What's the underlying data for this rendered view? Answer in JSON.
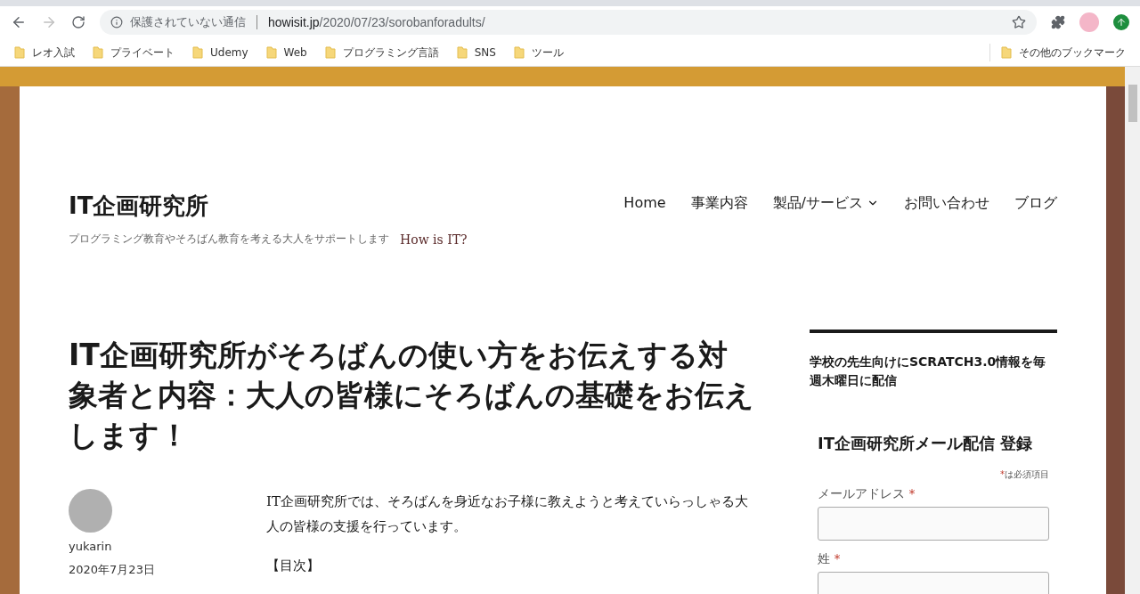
{
  "browser": {
    "security_label": "保護されていない通信",
    "url_host": "howisit.jp",
    "url_path": "/2020/07/23/sorobanforadults/",
    "bookmarks": [
      {
        "label": "レオ入試"
      },
      {
        "label": "プライベート"
      },
      {
        "label": "Udemy"
      },
      {
        "label": "Web"
      },
      {
        "label": "プログラミング言語"
      },
      {
        "label": "SNS"
      },
      {
        "label": "ツール"
      }
    ],
    "other_bookmarks": "その他のブックマーク"
  },
  "site": {
    "title": "IT企画研究所",
    "tagline": "プログラミング教育やそろばん教育を考える大人をサポートします",
    "tagline_suffix": "How is IT?"
  },
  "nav": [
    {
      "label": "Home",
      "dropdown": false
    },
    {
      "label": "事業内容",
      "dropdown": false
    },
    {
      "label": "製品/サービス",
      "dropdown": true
    },
    {
      "label": "お問い合わせ",
      "dropdown": false
    },
    {
      "label": "ブログ",
      "dropdown": false
    }
  ],
  "article": {
    "title": "IT企画研究所がそろばんの使い方をお伝えする対象者と内容：大人の皆様にそろばんの基礎をお伝えします！",
    "author": "yukarin",
    "date": "2020年7月23日",
    "paragraphs": [
      "IT企画研究所では、そろばんを身近なお子様に教えようと考えていらっしゃる大人の皆様の支援を行っています。",
      "【目次】"
    ]
  },
  "sidebar": {
    "widget_title": "学校の先生向けにSCRATCH3.0情報を毎週木曜日に配信",
    "form_title": "IT企画研究所メール配信 登録",
    "required_note": "は必須項目",
    "required_mark": "*",
    "fields": [
      {
        "label": "メールアドレス",
        "required": true
      },
      {
        "label": "姓",
        "required": true
      }
    ]
  }
}
